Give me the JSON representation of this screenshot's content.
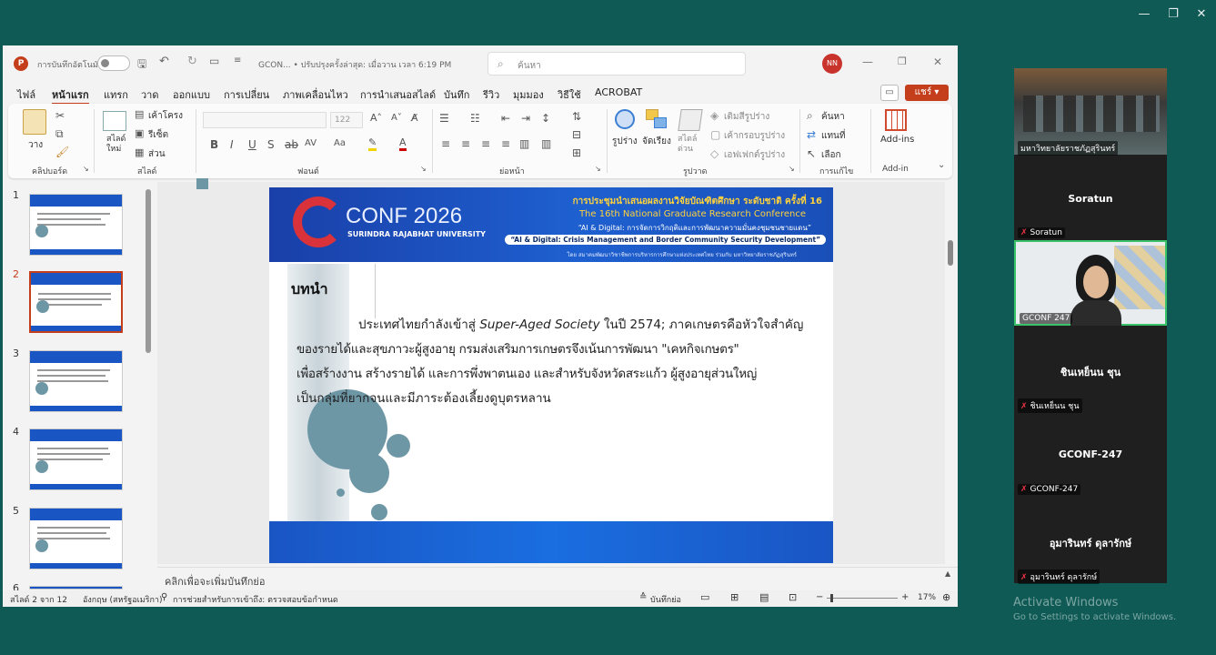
{
  "app": {
    "autosave_label": "การบันทึกอัตโนมัติ",
    "doc_title": "GCON... • ปรับปรุงครั้งล่าสุด: เมื่อวาน เวลา 6:19 PM",
    "search_placeholder": "ค้นหา",
    "avatar_initials": "NN",
    "share_label": "แชร์"
  },
  "tabs": [
    "ไฟล์",
    "หน้าแรก",
    "แทรก",
    "วาด",
    "ออกแบบ",
    "การเปลี่ยน",
    "ภาพเคลื่อนไหว",
    "การนำเสนอสไลด์",
    "บันทึก",
    "รีวิว",
    "มุมมอง",
    "วิธีใช้",
    "ACROBAT"
  ],
  "ribbon": {
    "paste": "วาง",
    "clipboard_group": "คลิปบอร์ด",
    "new_slide": "สไลด์ใหม่",
    "layout": "เค้าโครง",
    "reset": "รีเซ็ต",
    "section": "ส่วน",
    "slides_group": "สไลด์",
    "font_size": "122",
    "font_group": "ฟอนต์",
    "paragraph_group": "ย่อหน้า",
    "shapes": "รูปร่าง",
    "arrange": "จัดเรียง",
    "quick_styles": "สไตล์ด่วน",
    "shape_fill": "เติมสีรูปร่าง",
    "shape_outline": "เค้ากรอบรูปร่าง",
    "shape_effects": "เอฟเฟกต์รูปร่าง",
    "drawing_group": "รูปวาด",
    "find": "ค้นหา",
    "replace": "แทนที่",
    "select": "เลือก",
    "editing_group": "การแก้ไข",
    "addins": "Add-ins",
    "addins_group": "Add-in"
  },
  "thumbnails": [
    "1",
    "2",
    "3",
    "4",
    "5",
    "6"
  ],
  "slide": {
    "banner_line1": "การประชุมนำเสนอผลงานวิจัยบัณฑิตศึกษา ระดับชาติ ครั้งที่ 16",
    "banner_line2": "The 16th National Graduate Research Conference",
    "banner_line3": "“AI & Digital: การจัดการวิกฤติและการพัฒนาความมั่นคงชุมชนชายแดน”",
    "banner_line4": "“AI & Digital: Crisis Management and Border Community Security Development”",
    "banner_line5": "โดย สมาคมพัฒนาวิชาชีพการบริหารการศึกษาแห่งประเทศไทย ร่วมกับ มหาวิทยาลัยราชภัฏสุรินทร์",
    "logo_text": "CONF 2026",
    "logo_sub": "SURINDRA RAJABHAT UNIVERSITY",
    "heading": "บทนำ",
    "body_l1a": "ประเทศไทยกำลังเข้าสู่ ",
    "body_l1b": "Super-Aged   Society",
    "body_l1c": "  ในปี 2574; ภาคเกษตรคือหัวใจสำคัญ",
    "body_l2": "ของรายได้และสุขภาวะผู้สูงอายุ กรมส่งเสริมการเกษตรจึงเน้นการพัฒนา \"เคหกิจเกษตร\"",
    "body_l3": "เพื่อสร้างงาน  สร้างรายได้ และการพึ่งพาตนเอง และสำหรับจังหวัดสระแก้ว ผู้สูงอายุส่วนใหญ่",
    "body_l4": "เป็นกลุ่มที่ยากจนและมีภาระต้องเลี้ยงดูบุตรหลาน"
  },
  "notes_placeholder": "คลิกเพื่อจะเพิ่มบันทึกย่อ",
  "status": {
    "slide_pos": "สไลด์ 2 จาก 12",
    "language": "อังกฤษ (สหรัฐอเมริกา)",
    "accessibility": "การช่วยสำหรับการเข้าถึง: ตรวจสอบข้อกำหนด",
    "notes_btn": "บันทึกย่อ",
    "zoom": "17%"
  },
  "meeting": {
    "tile1_label": "มหาวิทยาลัยราชภัฏสุรินทร์",
    "tile2_name": "Soratun",
    "tile2_label": "Soratun",
    "tile3_label": "GCONF 247",
    "tile4_name": "ชินเหย็นน ชุน",
    "tile4_label": "ชินเหย็นน ชุน",
    "tile5_name": "GCONF-247",
    "tile5_label": "GCONF-247",
    "tile6_name": "อุมารินทร์ ดุลารักษ์",
    "tile6_label": "อุมารินทร์ ดุลารักษ์"
  },
  "activate": {
    "title": "Activate Windows",
    "sub": "Go to Settings to activate Windows."
  },
  "colors": {
    "desktop": "#0f5a55",
    "ppt_accent": "#c43e1c",
    "slide_blue": "#1a55c4",
    "circle": "#6e97a6"
  }
}
